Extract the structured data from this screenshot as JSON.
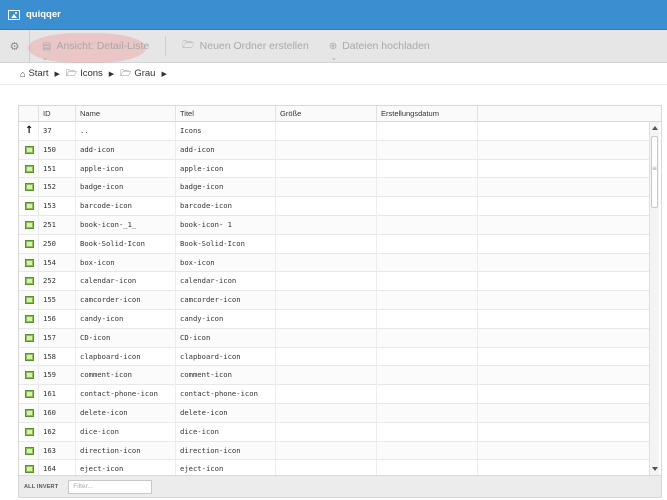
{
  "app": {
    "title": "quiqqer",
    "icon": "image-icon"
  },
  "toolbar": {
    "sitemap_icon": "sitemap-icon",
    "view_label": "Ansicht: Detail-Liste",
    "new_folder_label": "Neuen Ordner erstellen",
    "upload_label": "Dateien hochladen"
  },
  "breadcrumb": [
    {
      "label": "Start",
      "icon": "home-icon"
    },
    {
      "label": "Icons",
      "icon": "folder-icon"
    },
    {
      "label": "Grau",
      "icon": "folder-icon"
    }
  ],
  "grid": {
    "columns": [
      "",
      "ID",
      "Name",
      "Titel",
      "Größe",
      "Erstellungsdatum"
    ],
    "rows": [
      {
        "type": "up",
        "id": "37",
        "name": "..",
        "title": "Icons",
        "size": "",
        "created": ""
      },
      {
        "type": "image",
        "id": "150",
        "name": "add-icon",
        "title": "add-icon",
        "size": "",
        "created": ""
      },
      {
        "type": "image",
        "id": "151",
        "name": "apple-icon",
        "title": "apple-icon",
        "size": "",
        "created": ""
      },
      {
        "type": "image",
        "id": "152",
        "name": "badge-icon",
        "title": "badge-icon",
        "size": "",
        "created": ""
      },
      {
        "type": "image",
        "id": "153",
        "name": "barcode-icon",
        "title": "barcode-icon",
        "size": "",
        "created": ""
      },
      {
        "type": "image",
        "id": "251",
        "name": "book-icon-_1_",
        "title": "book-icon- 1",
        "size": "",
        "created": ""
      },
      {
        "type": "image",
        "id": "250",
        "name": "Book-Solid-Icon",
        "title": "Book-Solid-Icon",
        "size": "",
        "created": ""
      },
      {
        "type": "image",
        "id": "154",
        "name": "box-icon",
        "title": "box-icon",
        "size": "",
        "created": ""
      },
      {
        "type": "image",
        "id": "252",
        "name": "calendar-icon",
        "title": "calendar-icon",
        "size": "",
        "created": ""
      },
      {
        "type": "image",
        "id": "155",
        "name": "camcorder-icon",
        "title": "camcorder-icon",
        "size": "",
        "created": ""
      },
      {
        "type": "image",
        "id": "156",
        "name": "candy-icon",
        "title": "candy-icon",
        "size": "",
        "created": ""
      },
      {
        "type": "image",
        "id": "157",
        "name": "CD-icon",
        "title": "CD-icon",
        "size": "",
        "created": ""
      },
      {
        "type": "image",
        "id": "158",
        "name": "clapboard-icon",
        "title": "clapboard-icon",
        "size": "",
        "created": ""
      },
      {
        "type": "image",
        "id": "159",
        "name": "comment-icon",
        "title": "comment-icon",
        "size": "",
        "created": ""
      },
      {
        "type": "image",
        "id": "161",
        "name": "contact-phone-icon",
        "title": "contact-phone-icon",
        "size": "",
        "created": ""
      },
      {
        "type": "image",
        "id": "160",
        "name": "delete-icon",
        "title": "delete-icon",
        "size": "",
        "created": ""
      },
      {
        "type": "image",
        "id": "162",
        "name": "dice-icon",
        "title": "dice-icon",
        "size": "",
        "created": ""
      },
      {
        "type": "image",
        "id": "163",
        "name": "direction-icon",
        "title": "direction-icon",
        "size": "",
        "created": ""
      },
      {
        "type": "image",
        "id": "164",
        "name": "eject-icon",
        "title": "eject-icon",
        "size": "",
        "created": ""
      }
    ]
  },
  "footer": {
    "toggle_label": "ALL INVERT",
    "filter_placeholder": "Filter..."
  },
  "colors": {
    "titlebar": "#3b8fd0",
    "toolbar": "#e6e6e6",
    "highlight": "#f0a0a0"
  }
}
